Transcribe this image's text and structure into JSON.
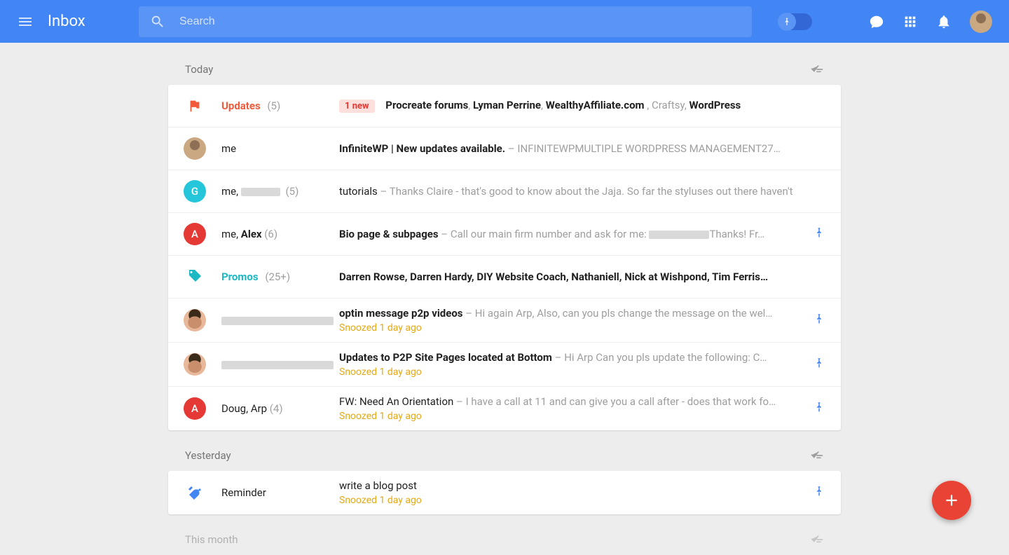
{
  "header": {
    "title": "Inbox",
    "search_placeholder": "Search"
  },
  "sections": {
    "today": {
      "label": "Today"
    },
    "yesterday": {
      "label": "Yesterday"
    },
    "this_month": {
      "label": "This month"
    }
  },
  "today": {
    "updates": {
      "name": "Updates",
      "count": "(5)",
      "badge": "1 new",
      "sources_pre": "Procreate forums",
      "sources_mid1": "Lyman Perrine",
      "sources_mid2": "WealthyAffiliate.com",
      "sources_plain": ", Craftsy, ",
      "sources_end": "WordPress"
    },
    "r1": {
      "sender": "me",
      "subject": "InfiniteWP | New updates available.",
      "preview": " – INFINITEWPMULTIPLE WORDPRESS MANAGEMENT27…"
    },
    "r2": {
      "sender_pre": "me, ",
      "count": "(5)",
      "subject": "tutorials",
      "preview": " – Thanks Claire - that's good to know about the Jaja. So far the styluses out there haven't"
    },
    "r3": {
      "sender_pre": "me, ",
      "sender_bold": "Alex",
      "count": " (6)",
      "subject": "Bio page & subpages",
      "preview_a": " – Call our main firm number and ask for me: ",
      "preview_b": "Thanks! Fr…"
    },
    "promos": {
      "name": "Promos",
      "count": "(25+)",
      "sources": "Darren Rowse, Darren Hardy, DIY Website Coach, Nathaniell, Nick at Wishpond, Tim Ferris…"
    },
    "r4": {
      "subject": "optin message p2p videos",
      "preview": " – Hi again Arp, Also, can you pls change the message on the wel…",
      "snooze": "Snoozed 1 day ago"
    },
    "r5": {
      "subject": "Updates to P2P Site Pages located at Bottom",
      "preview": " – Hi Arp Can you pls update the following: C…",
      "snooze": "Snoozed 1 day ago"
    },
    "r6": {
      "sender": "Doug, Arp ",
      "count": "(4)",
      "subject": "FW: Need An Orientation",
      "preview": " – I have a call at 11 and can give you a call after - does that work fo…",
      "snooze": "Snoozed 1 day ago"
    }
  },
  "yesterday": {
    "reminder": {
      "sender": "Reminder",
      "subject": "write a blog post",
      "snooze": "Snoozed 1 day ago"
    }
  },
  "avatar_letters": {
    "g": "G",
    "a": "A",
    "a2": "A"
  }
}
